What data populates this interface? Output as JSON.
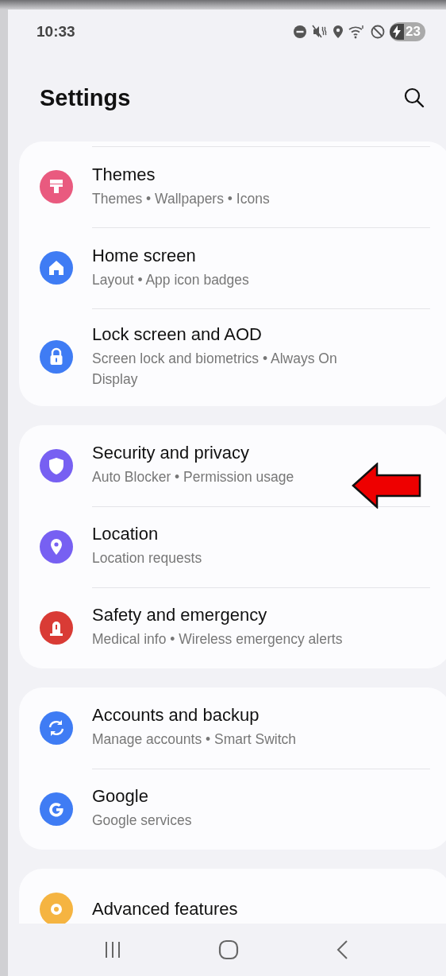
{
  "status_bar": {
    "time": "10:33",
    "battery": "23"
  },
  "header": {
    "title": "Settings"
  },
  "groups": [
    {
      "items": [
        {
          "title": "Themes",
          "subtitle": "Themes • Wallpapers • Icons",
          "kind": "brush",
          "color": "#e95a7f"
        },
        {
          "title": "Home screen",
          "subtitle": "Layout • App icon badges",
          "kind": "home",
          "color": "#3f7cf4"
        },
        {
          "title": "Lock screen and AOD",
          "subtitle": "Screen lock and biometrics • Always On Display",
          "kind": "lock",
          "color": "#3f7cf4"
        }
      ]
    },
    {
      "items": [
        {
          "title": "Security and privacy",
          "subtitle": "Auto Blocker • Permission usage",
          "kind": "shield",
          "color": "#7760f2"
        },
        {
          "title": "Location",
          "subtitle": "Location requests",
          "kind": "pin",
          "color": "#7760f2"
        },
        {
          "title": "Safety and emergency",
          "subtitle": "Medical info • Wireless emergency alerts",
          "kind": "siren",
          "color": "#d93b35"
        }
      ]
    },
    {
      "items": [
        {
          "title": "Accounts and backup",
          "subtitle": "Manage accounts • Smart Switch",
          "kind": "sync",
          "color": "#3f7cf4"
        },
        {
          "title": "Google",
          "subtitle": "Google services",
          "kind": "google",
          "color": "#3f7cf4"
        }
      ]
    },
    {
      "items": [
        {
          "title": "Advanced features",
          "kind": "gear",
          "color": "#f5b441"
        }
      ]
    }
  ]
}
